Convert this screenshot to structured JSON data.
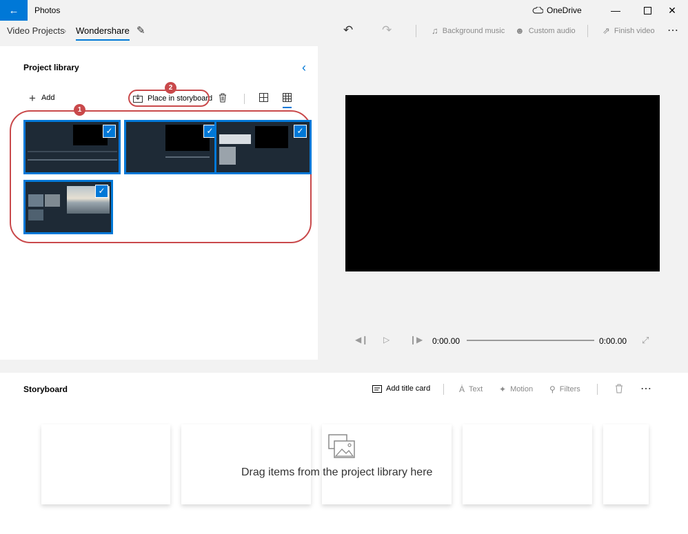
{
  "titlebar": {
    "app_title": "Photos",
    "onedrive_label": "OneDrive",
    "back_icon": "arrow-left-icon",
    "accent": "#0078d7"
  },
  "commandbar": {
    "breadcrumb": [
      "Video Projects",
      "Wondershare"
    ],
    "background_music": "Background music",
    "custom_audio": "Custom audio",
    "finish_video": "Finish video"
  },
  "library": {
    "title": "Project library",
    "add_label": "Add",
    "place_label": "Place in storyboard",
    "thumbnails": [
      {
        "selected": true,
        "scene": "editor-dark"
      },
      {
        "selected": true,
        "scene": "dialog-dark"
      },
      {
        "selected": true,
        "scene": "editor-clips"
      },
      {
        "selected": true,
        "scene": "editor-sunset"
      }
    ]
  },
  "annotations": {
    "marker_1": "1",
    "marker_2": "2",
    "color": "#c9494b"
  },
  "preview": {
    "time_current": "0:00.00",
    "time_total": "0:00.00"
  },
  "storyboard": {
    "title": "Storyboard",
    "add_title_card": "Add title card",
    "text": "Text",
    "motion": "Motion",
    "filters": "Filters",
    "empty_message": "Drag items from the project library here"
  }
}
